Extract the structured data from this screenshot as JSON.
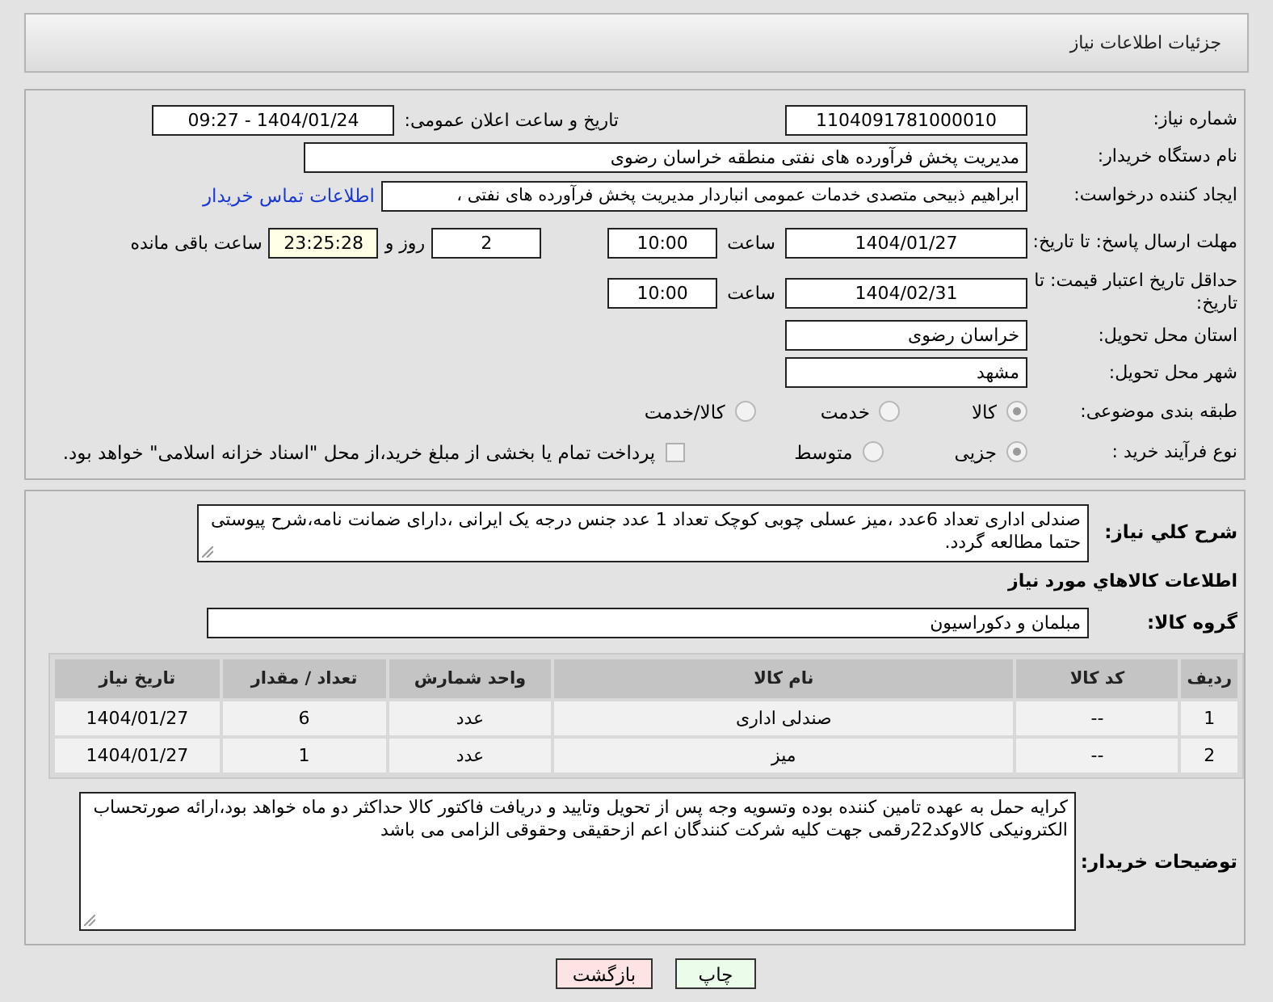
{
  "header": {
    "title": "جزئیات اطلاعات نیاز"
  },
  "need_number": {
    "label": "شماره نیاز:",
    "value": "1104091781000010"
  },
  "announce": {
    "label": "تاریخ و ساعت اعلان عمومی:",
    "value": "1404/01/24 - 09:27"
  },
  "buyer_org": {
    "label": "نام دستگاه خریدار:",
    "value": "مدیریت پخش فرآورده های نفتی منطقه خراسان رضوی"
  },
  "requester": {
    "label": "ایجاد کننده درخواست:",
    "value": "ابراهیم ذبیحی متصدی خدمات عمومی انباردار مدیریت پخش فرآورده های نفتی ،",
    "link": "اطلاعات تماس خریدار"
  },
  "reply_deadline": {
    "label": "مهلت ارسال پاسخ: تا تاریخ:",
    "date": "1404/01/27",
    "time_label": "ساعت",
    "time": "10:00",
    "days": "2",
    "days_label": "روز و",
    "remaining": "23:25:28",
    "remaining_label": "ساعت باقی مانده"
  },
  "price_validity": {
    "label": "حداقل تاریخ اعتبار قیمت: تا تاریخ:",
    "date": "1404/02/31",
    "time_label": "ساعت",
    "time": "10:00"
  },
  "province": {
    "label": "استان محل تحویل:",
    "value": "خراسان رضوی"
  },
  "city": {
    "label": "شهر محل تحویل:",
    "value": "مشهد"
  },
  "category": {
    "label": "طبقه بندی موضوعی:",
    "options": [
      {
        "label": "کالا",
        "selected": true
      },
      {
        "label": "خدمت",
        "selected": false
      },
      {
        "label": "کالا/خدمت",
        "selected": false
      }
    ]
  },
  "process": {
    "label": "نوع فرآیند خرید :",
    "options": [
      {
        "label": "جزیی",
        "selected": true
      },
      {
        "label": "متوسط",
        "selected": false
      }
    ],
    "payment": {
      "label": "پرداخت تمام یا بخشی از مبلغ خرید،از محل \"اسناد خزانه اسلامی\" خواهد بود.",
      "checked": false
    }
  },
  "description": {
    "label": "شرح كلي نياز:",
    "value": "صندلی اداری تعداد 6عدد ،میز عسلی چوبی کوچک تعداد 1 عدد جنس درجه یک ایرانی ،دارای ضمانت نامه،شرح پیوستی حتما مطالعه گردد."
  },
  "goods_heading": "اطلاعات كالاهاي مورد نياز",
  "goods_group": {
    "label": "گروه کالا:",
    "value": "مبلمان و دکوراسیون"
  },
  "table": {
    "columns": [
      "ردیف",
      "کد کالا",
      "نام کالا",
      "واحد شمارش",
      "تعداد / مقدار",
      "تاریخ نیاز"
    ],
    "rows": [
      [
        "1",
        "--",
        "صندلی اداری",
        "عدد",
        "6",
        "1404/01/27"
      ],
      [
        "2",
        "--",
        "میز",
        "عدد",
        "1",
        "1404/01/27"
      ]
    ]
  },
  "buyer_notes": {
    "label": "توضیحات خریدار:",
    "value": "کرایه حمل به عهده تامین کننده بوده وتسویه وجه پس از تحویل وتایید و دریافت فاکتور کالا حداکثر دو ماه خواهد بود،ارائه صورتحساب الکترونیکی کالاوکد22رقمی جهت کلیه شرکت کنندگان اعم ازحقیقی وحقوقی الزامی می باشد"
  },
  "buttons": [
    {
      "label": "چاپ",
      "kind": "print"
    },
    {
      "label": "بازگشت",
      "kind": "back"
    }
  ]
}
